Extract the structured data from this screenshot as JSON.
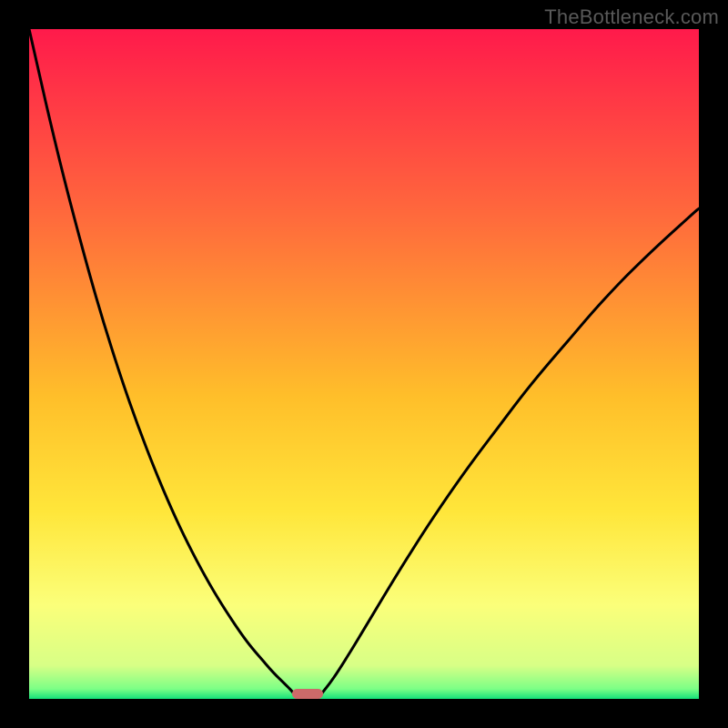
{
  "watermark": "TheBottleneck.com",
  "chart_data": {
    "type": "line",
    "title": "",
    "xlabel": "",
    "ylabel": "",
    "xlim": [
      0,
      100
    ],
    "ylim": [
      0,
      100
    ],
    "gradient": {
      "stops": [
        {
          "pos": 0,
          "color": "#ff1a4b"
        },
        {
          "pos": 0.28,
          "color": "#ff6a3c"
        },
        {
          "pos": 0.55,
          "color": "#ffbf2a"
        },
        {
          "pos": 0.72,
          "color": "#ffe63a"
        },
        {
          "pos": 0.86,
          "color": "#fbff7a"
        },
        {
          "pos": 0.95,
          "color": "#d8ff86"
        },
        {
          "pos": 0.985,
          "color": "#7cff86"
        },
        {
          "pos": 1.0,
          "color": "#14e07a"
        }
      ]
    },
    "series": [
      {
        "name": "left-curve",
        "x": [
          0.0,
          2.5,
          5.0,
          7.5,
          10.0,
          12.5,
          15.0,
          17.5,
          20.0,
          22.5,
          25.0,
          27.5,
          30.0,
          32.5,
          35.0,
          36.5,
          38.0,
          39.0,
          39.7,
          40.3
        ],
        "y": [
          100.0,
          89.0,
          78.6,
          69.0,
          60.0,
          51.8,
          44.3,
          37.5,
          31.3,
          25.7,
          20.7,
          16.2,
          12.2,
          8.6,
          5.6,
          3.9,
          2.4,
          1.4,
          0.6,
          0.0
        ]
      },
      {
        "name": "right-curve",
        "x": [
          43.0,
          44.0,
          45.5,
          47.5,
          50.0,
          53.0,
          56.5,
          60.5,
          65.0,
          70.0,
          75.0,
          80.5,
          86.0,
          92.0,
          98.5,
          100.0
        ],
        "y": [
          0.0,
          1.2,
          3.2,
          6.3,
          10.4,
          15.4,
          21.1,
          27.3,
          33.8,
          40.5,
          47.0,
          53.5,
          59.8,
          65.9,
          71.9,
          73.2
        ]
      }
    ],
    "marker": {
      "name": "bottleneck-marker",
      "x_center": 41.6,
      "width_pct": 4.6,
      "height_pct": 1.5,
      "color": "#cc6a69"
    }
  }
}
